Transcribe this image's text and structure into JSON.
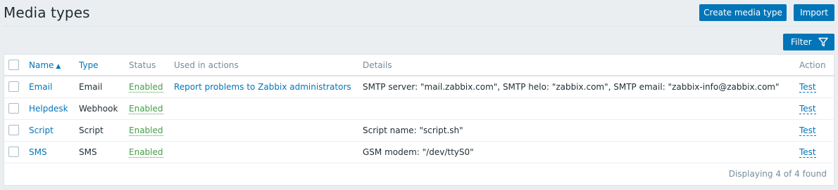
{
  "header": {
    "title": "Media types",
    "create_label": "Create media type",
    "import_label": "Import",
    "filter_label": "Filter"
  },
  "table": {
    "columns": {
      "name": "Name",
      "type": "Type",
      "status": "Status",
      "used": "Used in actions",
      "details": "Details",
      "action": "Action"
    },
    "rows": [
      {
        "name": "Email",
        "type": "Email",
        "status": "Enabled",
        "used": "Report problems to Zabbix administrators",
        "details": "SMTP server: \"mail.zabbix.com\", SMTP helo: \"zabbix.com\", SMTP email: \"zabbix-info@zabbix.com\"",
        "action": "Test"
      },
      {
        "name": "Helpdesk",
        "type": "Webhook",
        "status": "Enabled",
        "used": "",
        "details": "",
        "action": "Test"
      },
      {
        "name": "Script",
        "type": "Script",
        "status": "Enabled",
        "used": "",
        "details": "Script name: \"script.sh\"",
        "action": "Test"
      },
      {
        "name": "SMS",
        "type": "SMS",
        "status": "Enabled",
        "used": "",
        "details": "GSM modem: \"/dev/ttyS0\"",
        "action": "Test"
      }
    ],
    "footer": "Displaying 4 of 4 found"
  },
  "colors": {
    "accent": "#0275b8",
    "enabled": "#429e47",
    "background": "#ebeef0"
  }
}
